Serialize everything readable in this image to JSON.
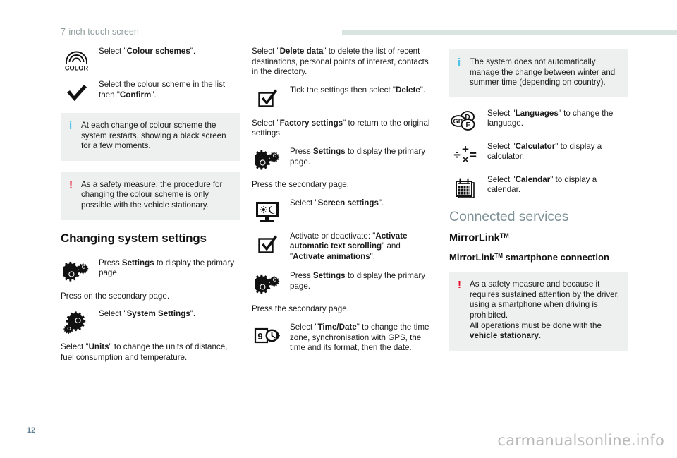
{
  "header": {
    "title": "7-inch touch screen"
  },
  "footer": {
    "page_number": "12",
    "watermark": "carmanualsonline.info"
  },
  "colors": {
    "info_mark": "#4ec3e8",
    "warn_mark": "#e8112d",
    "callout_bg": "#eef0f0",
    "rule": "#d9e3e0",
    "grey_heading": "#7d9096",
    "header_title": "#8c9a9b",
    "page_number": "#5c7c91",
    "watermark": "#b9b9b9"
  },
  "column1": {
    "row_colour_schemes": {
      "icon": "color-rainbow-icon",
      "icon_label": "COLOR",
      "text_plain_1": "Select \"",
      "text_bold_1": "Colour schemes",
      "text_plain_2": "\"."
    },
    "row_confirm": {
      "icon": "checkmark-icon",
      "text_plain_1": "Select the colour scheme in the list then \"",
      "text_bold_1": "Confirm",
      "text_plain_2": "\"."
    },
    "callout_info": {
      "mark": "i",
      "text": "At each change of colour scheme the system restarts, showing a black screen for a few moments."
    },
    "callout_warn": {
      "mark": "!",
      "text": "As a safety measure, the procedure for changing the colour scheme is only possible with the vehicle stationary."
    },
    "heading": "Changing system settings",
    "row_settings_primary": {
      "icon": "gears-settings-icon",
      "text_plain_1": "Press ",
      "text_bold_1": "Settings",
      "text_plain_2": " to display the primary page."
    },
    "para_secondary": "Press on the secondary page.",
    "row_system_settings": {
      "icon": "gears-system-settings-icon",
      "text_plain_1": "Select \"",
      "text_bold_1": "System Settings",
      "text_plain_2": "\"."
    },
    "para_units_1": "Select \"",
    "para_units_bold": "Units",
    "para_units_2": "\" to change the units of distance, fuel consumption and temperature."
  },
  "column2": {
    "para_delete_1": "Select \"",
    "para_delete_bold": "Delete data",
    "para_delete_2": "\" to delete the list of recent destinations, personal points of interest, contacts in the directory.",
    "row_tick_delete": {
      "icon": "checkbox-ticked-icon",
      "text_plain_1": "Tick the settings then select \"",
      "text_bold_1": "Delete",
      "text_plain_2": "\"."
    },
    "para_factory_1": "Select \"",
    "para_factory_bold": "Factory settings",
    "para_factory_2": "\" to return to the original settings.",
    "row_settings_primary": {
      "icon": "gears-settings-icon",
      "text_plain_1": "Press ",
      "text_bold_1": "Settings",
      "text_plain_2": " to display the primary page."
    },
    "para_secondary_1": "Press the secondary page.",
    "row_screen_settings": {
      "icon": "monitor-sun-moon-icon",
      "text_plain_1": "Select \"",
      "text_bold_1": "Screen settings",
      "text_plain_2": "\"."
    },
    "row_activate": {
      "icon": "checkbox-ticked-icon",
      "text_plain_1": "Activate or deactivate: \"",
      "text_bold_1": "Activate automatic text scrolling",
      "text_plain_2": "\" and \"",
      "text_bold_2": "Activate animations",
      "text_plain_3": "\"."
    },
    "row_settings_primary_2": {
      "icon": "gears-settings-icon",
      "text_plain_1": "Press ",
      "text_bold_1": "Settings",
      "text_plain_2": " to display the primary page."
    },
    "para_secondary_2": "Press the secondary page.",
    "row_time_date": {
      "icon": "calendar-clock-icon",
      "icon_digit": "9",
      "text_plain_1": "Select \"",
      "text_bold_1": "Time/Date",
      "text_plain_2": "\" to change the time zone, synchronisation with GPS, the time and its format, then the date."
    }
  },
  "column3": {
    "callout_info": {
      "mark": "i",
      "text": "The system does not automatically manage the change between winter and summer time (depending on country)."
    },
    "row_languages": {
      "icon": "languages-icon",
      "icon_labels": [
        "GB",
        "D",
        "F"
      ],
      "text_plain_1": "Select \"",
      "text_bold_1": "Languages",
      "text_plain_2": "\" to change the language."
    },
    "row_calculator": {
      "icon": "calculator-symbols-icon",
      "text_plain_1": "Select \"",
      "text_bold_1": "Calculator",
      "text_plain_2": "\" to display a calculator."
    },
    "row_calendar": {
      "icon": "calendar-icon",
      "text_plain_1": "Select \"",
      "text_bold_1": "Calendar",
      "text_plain_2": "\" to display a calendar."
    },
    "heading_connected_services": "Connected services",
    "heading_mirrorlink": "MirrorLink",
    "heading_mirrorlink_tm": "TM",
    "heading_mirrorlink_sub_1": "MirrorLink",
    "heading_mirrorlink_sub_tm": "TM",
    "heading_mirrorlink_sub_2": " smartphone connection",
    "callout_warn": {
      "mark": "!",
      "text_1": "As a safety measure and because it requires sustained attention by the driver, using a smartphone when driving is prohibited.",
      "text_2": "All operations must be done with the ",
      "text_bold": "vehicle stationary",
      "text_3": "."
    }
  }
}
